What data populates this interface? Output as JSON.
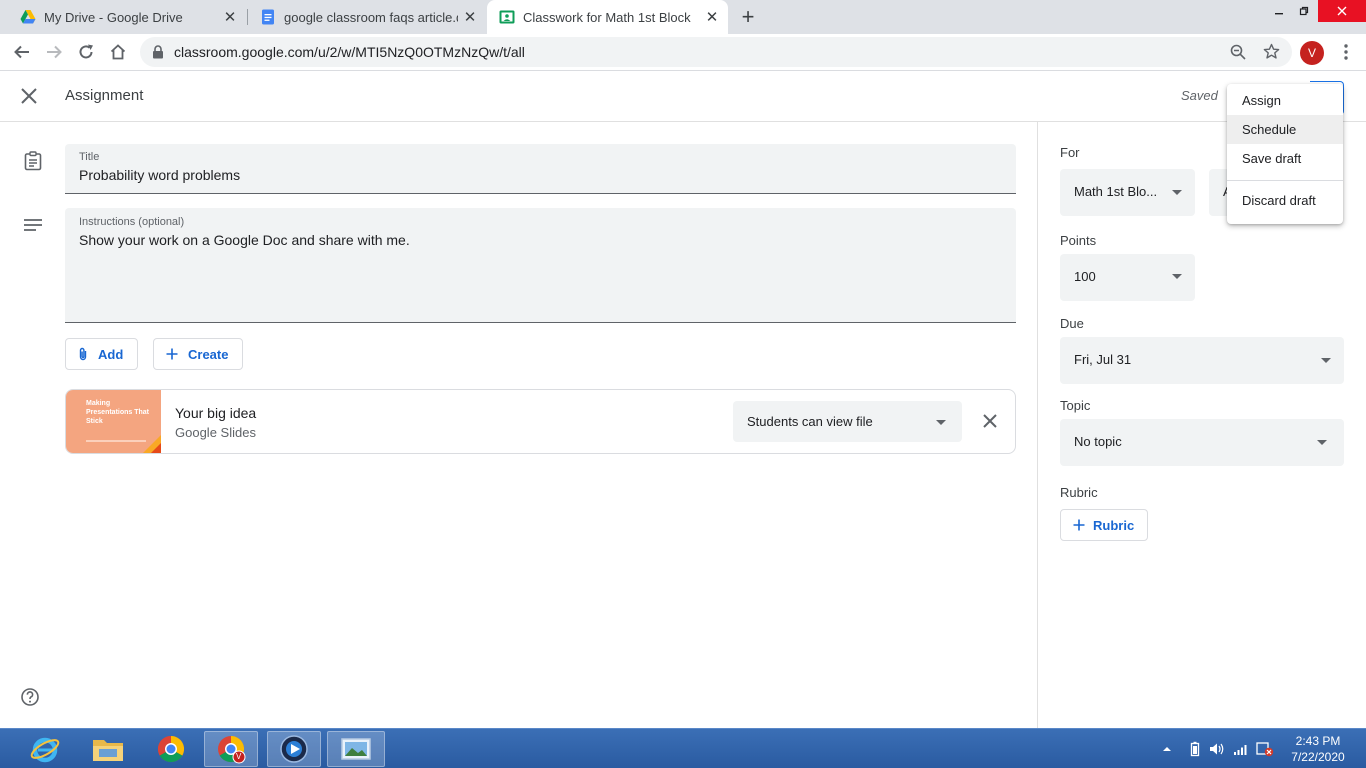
{
  "browser": {
    "tabs": [
      {
        "title": "My Drive - Google Drive",
        "icon": "google-drive-icon"
      },
      {
        "title": "google classroom faqs article.docx",
        "icon": "google-docs-icon"
      },
      {
        "title": "Classwork for Math 1st Block",
        "icon": "google-classroom-icon"
      }
    ],
    "url": "classroom.google.com/u/2/w/MTI5NzQ0OTMzNzQw/t/all",
    "profile_initial": "V"
  },
  "header": {
    "title": "Assignment",
    "status": "Saved"
  },
  "form": {
    "title_label": "Title",
    "title_value": "Probability word problems",
    "instructions_label": "Instructions (optional)",
    "instructions_value": "Show your work on a Google Doc and share with me.",
    "add_label": "Add",
    "create_label": "Create"
  },
  "attachment": {
    "thumb_title": "Making Presentations That Stick",
    "name": "Your big idea",
    "type": "Google Slides",
    "permission": "Students can view file"
  },
  "panel": {
    "for_label": "For",
    "for_value": "Math 1st Blo...",
    "for_second_partial": "A",
    "points_label": "Points",
    "points_value": "100",
    "due_label": "Due",
    "due_value": "Fri, Jul 31",
    "topic_label": "Topic",
    "topic_value": "No topic",
    "rubric_label": "Rubric",
    "rubric_button": "Rubric"
  },
  "menu": {
    "items": [
      "Assign",
      "Schedule",
      "Save draft",
      "Discard draft"
    ],
    "highlighted": "Schedule"
  },
  "taskbar": {
    "time": "2:43 PM",
    "date": "7/22/2020",
    "profile_badge": "V"
  },
  "colors": {
    "accent": "#1967d2",
    "tabstrip": "#dee1e6",
    "field_bg": "#f1f3f4",
    "taskbar": "#2a5ba1"
  }
}
